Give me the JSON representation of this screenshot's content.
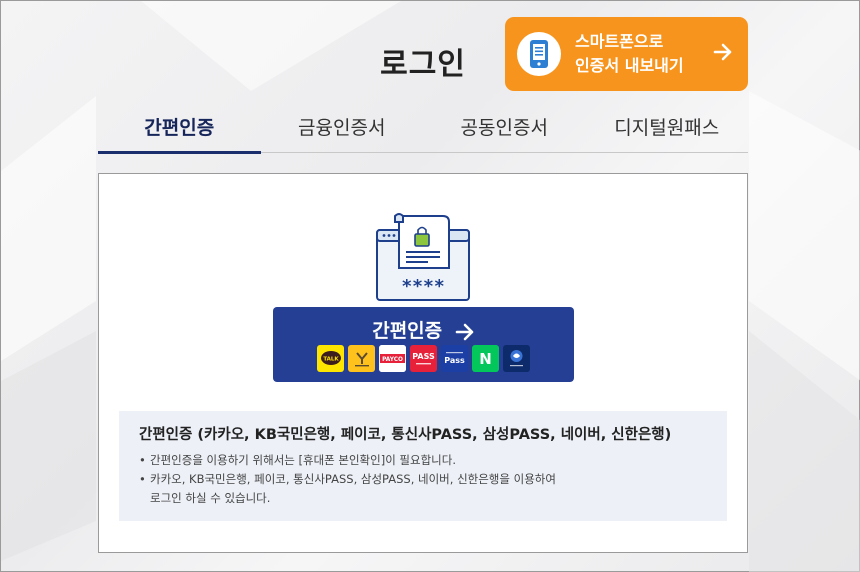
{
  "page": {
    "title": "로그인"
  },
  "export_button": {
    "line1": "스마트폰으로",
    "line2": "인증서 내보내기"
  },
  "tabs": [
    {
      "label": "간편인증",
      "active": true
    },
    {
      "label": "금융인증서",
      "active": false
    },
    {
      "label": "공동인증서",
      "active": false
    },
    {
      "label": "디지털원패스",
      "active": false
    }
  ],
  "illustration": {
    "masked_text": "****"
  },
  "easy_auth_button": {
    "label": "간편인증"
  },
  "providers": [
    {
      "name": "kakao",
      "label": "TALK",
      "bg": "#fee500",
      "fg": "#3c1e1e"
    },
    {
      "name": "kb",
      "label": "",
      "bg": "#ffc21d",
      "fg": "#5b4a32"
    },
    {
      "name": "payco",
      "label": "PAYCO",
      "bg": "#ffffff",
      "fg": "#ffffff"
    },
    {
      "name": "pass",
      "label": "PASS",
      "bg": "#e8213a",
      "fg": "#ffffff"
    },
    {
      "name": "samsung-pass",
      "label": "Pass",
      "bg": "#1c3fa6",
      "fg": "#ffffff"
    },
    {
      "name": "naver",
      "label": "N",
      "bg": "#03c75a",
      "fg": "#ffffff"
    },
    {
      "name": "shinhan",
      "label": "",
      "bg": "#0d2a6b",
      "fg": "#ffffff"
    }
  ],
  "info": {
    "title": "간편인증 (카카오, KB국민은행, 페이코, 통신사PASS, 삼성PASS, 네이버, 신한은행)",
    "bullets": [
      "간편인증을 이용하기 위해서는 [휴대폰 본인확인]이 필요합니다.",
      "카카오, KB국민은행, 페이코, 통신사PASS, 삼성PASS, 네이버, 신한은행을 이용하여\n로그인 하실 수 있습니다."
    ]
  },
  "colors": {
    "accent": "#f7941d",
    "primary": "#243f94",
    "tab_active": "#1a2d6c"
  }
}
